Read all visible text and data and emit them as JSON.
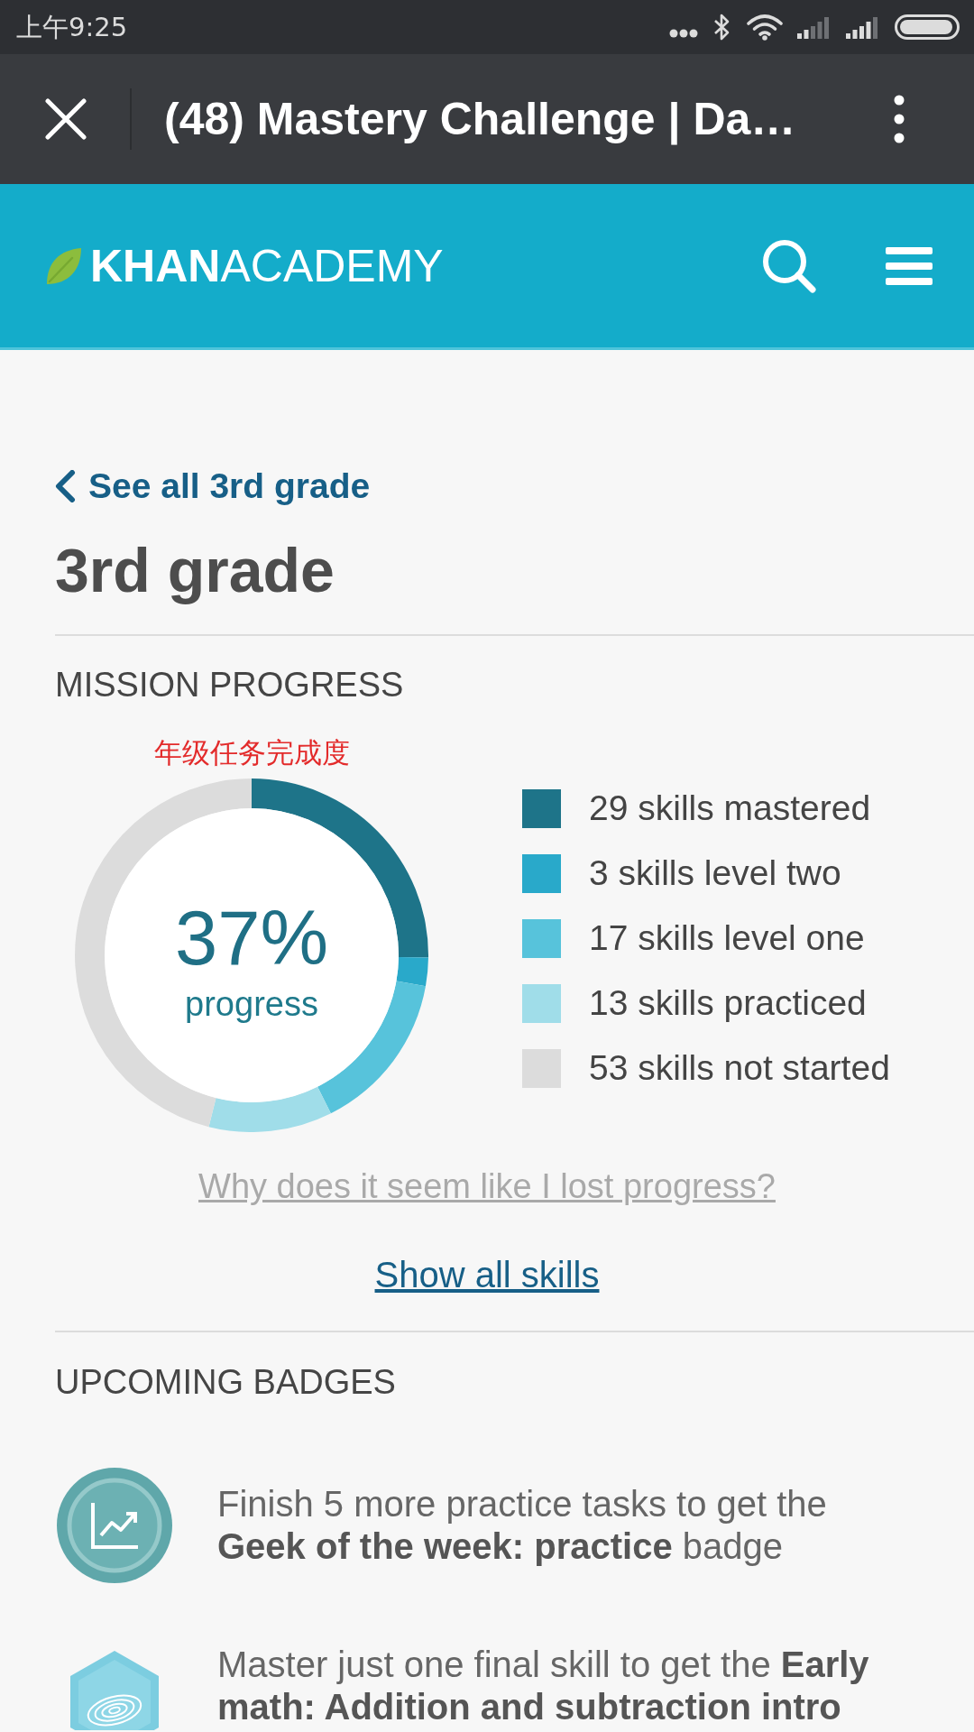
{
  "status_bar": {
    "time": "上午9:25"
  },
  "browser_bar": {
    "title": "(48) Mastery Challenge | Da…"
  },
  "site_header": {
    "logo": "**KHAN**ACADEMY"
  },
  "back_link": "See all 3rd grade",
  "page_title": "3rd grade",
  "mission_progress": {
    "heading": "MISSION PROGRESS",
    "annotation": "年级任务完成度",
    "percent": "37%",
    "percent_label": "progress",
    "chart_data": {
      "type": "donut",
      "values": [
        25.2,
        2.6,
        14.8,
        11.3,
        46.1
      ]
    },
    "legend": [
      {
        "label": "29 skills mastered",
        "color": "#1e7489"
      },
      {
        "label": "3 skills level two",
        "color": "#29a9ca"
      },
      {
        "label": "17 skills level one",
        "color": "#57c3db"
      },
      {
        "label": "13 skills practiced",
        "color": "#a0dde9"
      },
      {
        "label": "53 skills not started",
        "color": "#dcdcdc"
      }
    ],
    "help_link": "Why does it seem like I lost progress?",
    "show_all_link": "Show all skills"
  },
  "upcoming_badges": {
    "heading": "UPCOMING BADGES",
    "items": [
      {
        "kind": "circle",
        "text": "Finish 5 more practice tasks to get the **Geek of the week: practice** badge"
      },
      {
        "kind": "hexagon",
        "text": "Master just one final skill to get the **Early math: Addition and subtraction intro**"
      }
    ]
  }
}
